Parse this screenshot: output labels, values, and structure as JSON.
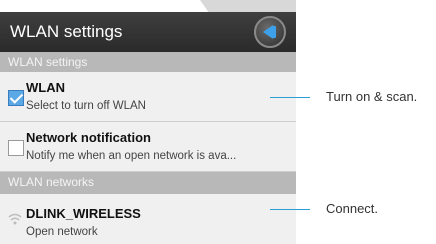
{
  "title": "WLAN settings",
  "section_settings": "WLAN settings",
  "wlan": {
    "title": "WLAN",
    "subtitle": "Select to turn off WLAN",
    "checked": true
  },
  "notification": {
    "title": "Network notification",
    "subtitle": "Notify me when an open network is ava...",
    "checked": false
  },
  "section_networks": "WLAN networks",
  "network": {
    "name": "DLINK_WIRELESS",
    "status": "Open network"
  },
  "annotations": {
    "turn_on": "Turn on & scan.",
    "connect": "Connect."
  },
  "colors": {
    "accent": "#2a9fd6",
    "checkbox": "#5aa9e6",
    "titlebar": "#333333"
  }
}
